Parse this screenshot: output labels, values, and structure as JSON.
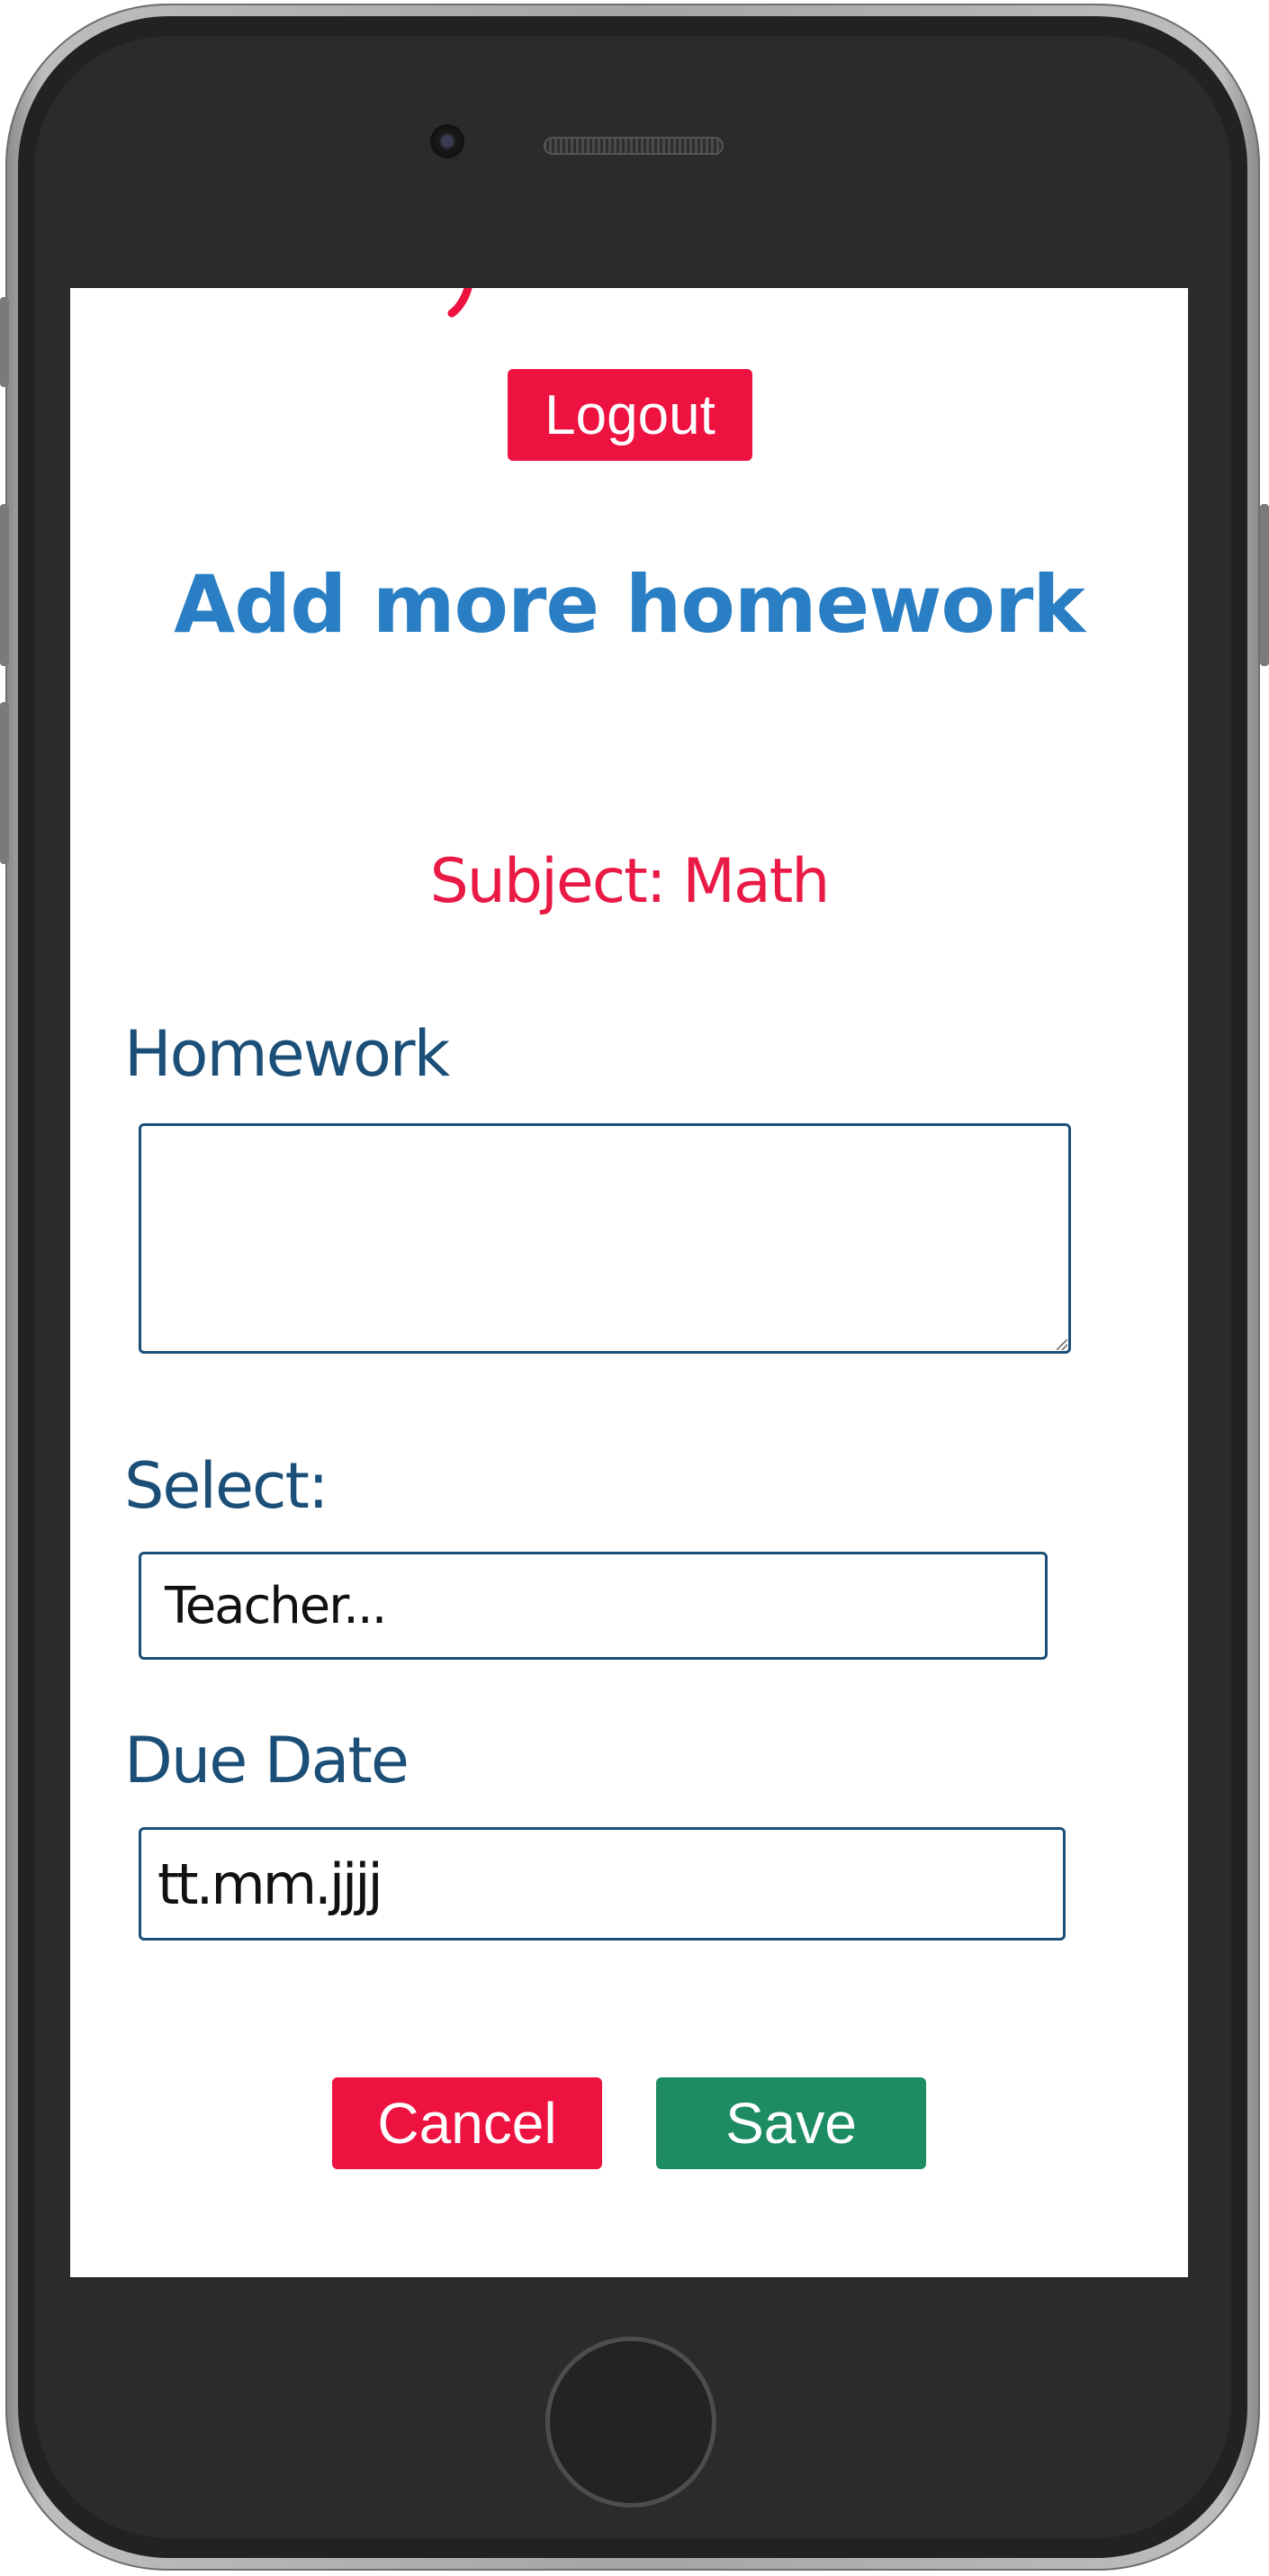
{
  "header": {
    "logout_label": "Logout"
  },
  "page": {
    "title": "Add more homework",
    "subject": "Subject: Math"
  },
  "form": {
    "homework_label": "Homework",
    "homework_value": "",
    "select_label": "Select:",
    "select_value": "Teacher...",
    "due_label": "Due Date",
    "due_value": "tt.mm.jjjj"
  },
  "actions": {
    "cancel_label": "Cancel",
    "save_label": "Save"
  },
  "colors": {
    "danger": "#ee1240",
    "success": "#1e8c62",
    "title": "#2a7fc4",
    "subject": "#ea1a46",
    "label": "#1b4f78"
  }
}
